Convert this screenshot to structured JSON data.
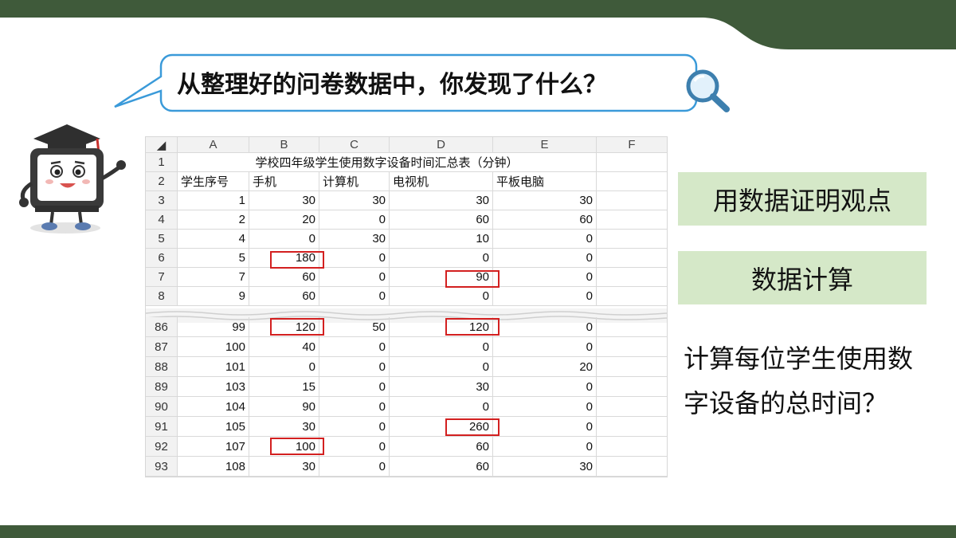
{
  "question": "从整理好的问卷数据中，你发现了什么？",
  "colors": {
    "dark_green": "#3f5a3a",
    "light_green": "#d5e8c8",
    "bubble_border": "#3a9ad9",
    "highlight_red": "#d32020"
  },
  "spreadsheet": {
    "column_headers": [
      "A",
      "B",
      "C",
      "D",
      "E",
      "F"
    ],
    "row_numbers": [
      "1",
      "2",
      "3",
      "4",
      "5",
      "6",
      "7",
      "8",
      "86",
      "87",
      "88",
      "89",
      "90",
      "91",
      "92",
      "93"
    ],
    "title": "学校四年级学生使用数字设备时间汇总表（分钟）",
    "headers": [
      "学生序号",
      "手机",
      "计算机",
      "电视机",
      "平板电脑"
    ],
    "rows": [
      [
        "1",
        "30",
        "30",
        "30",
        "30"
      ],
      [
        "2",
        "20",
        "0",
        "60",
        "60"
      ],
      [
        "4",
        "0",
        "30",
        "10",
        "0"
      ],
      [
        "5",
        "180",
        "0",
        "0",
        "0"
      ],
      [
        "7",
        "60",
        "0",
        "90",
        "0"
      ],
      [
        "9",
        "60",
        "0",
        "0",
        "0"
      ],
      [
        "99",
        "120",
        "50",
        "120",
        "0"
      ],
      [
        "100",
        "40",
        "0",
        "0",
        "0"
      ],
      [
        "101",
        "0",
        "0",
        "0",
        "20"
      ],
      [
        "103",
        "15",
        "0",
        "30",
        "0"
      ],
      [
        "104",
        "90",
        "0",
        "0",
        "0"
      ],
      [
        "105",
        "30",
        "0",
        "260",
        "0"
      ],
      [
        "107",
        "100",
        "0",
        "60",
        "0"
      ],
      [
        "108",
        "30",
        "0",
        "60",
        "30"
      ]
    ],
    "highlighted_cells": [
      "B6",
      "D7",
      "B86",
      "D86",
      "D91",
      "B92"
    ]
  },
  "actions": [
    "用数据证明观点",
    "数据计算"
  ],
  "note": "计算每位学生使用数字设备的总时间？"
}
